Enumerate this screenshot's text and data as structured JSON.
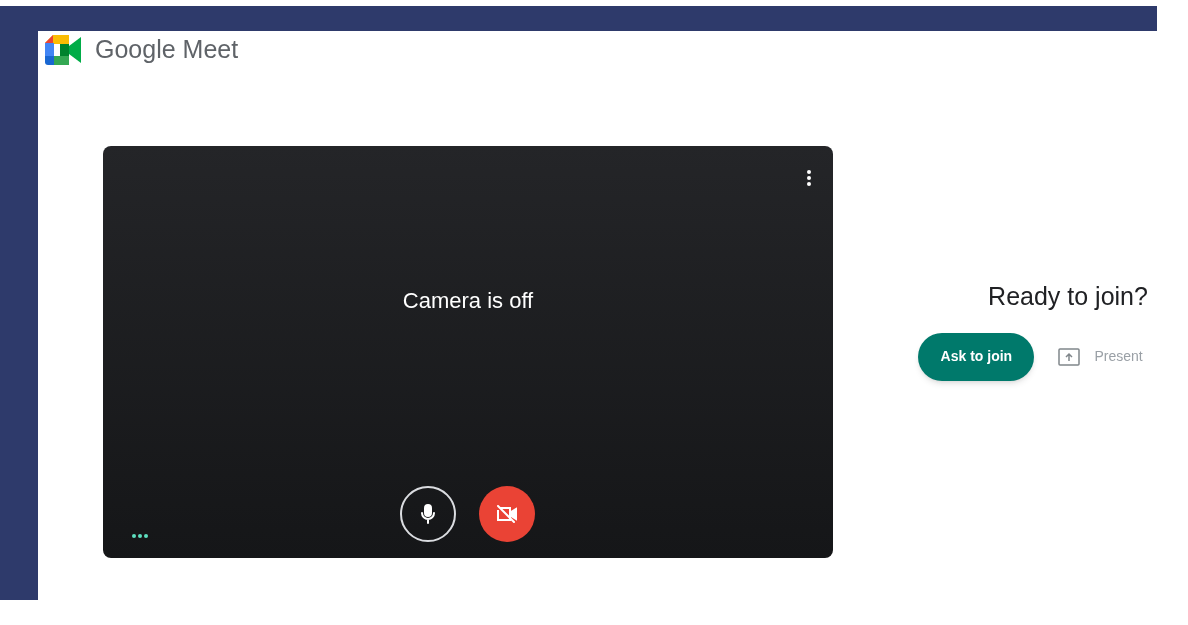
{
  "header": {
    "app_name": "Google Meet"
  },
  "preview": {
    "message": "Camera is off",
    "controls": [
      {
        "kind": "mic",
        "on": true
      },
      {
        "kind": "camera",
        "on": false
      }
    ]
  },
  "join_panel": {
    "title": "Ready to join?",
    "primary_button": "Ask to join",
    "secondary_button": "Present"
  }
}
